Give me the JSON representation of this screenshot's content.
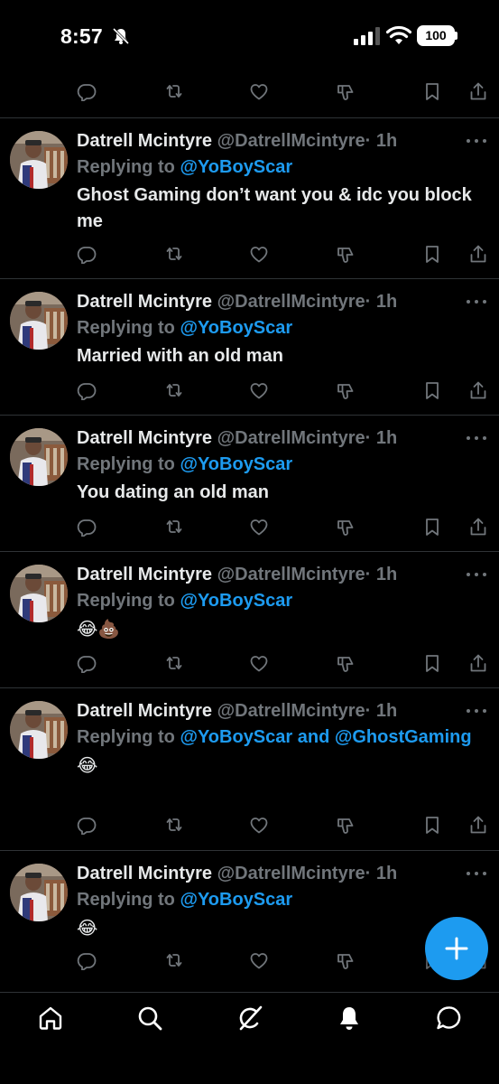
{
  "status_bar": {
    "time": "8:57",
    "battery": "100"
  },
  "icons": {
    "reply": "reply-icon",
    "retweet": "retweet-icon",
    "like": "like-icon",
    "downvote": "downvote-icon",
    "bookmark": "bookmark-icon",
    "share": "share-icon",
    "more": "more-icon",
    "compose": "plus-icon",
    "home": "home-icon",
    "search": "search-icon",
    "grok": "grok-icon",
    "notifications": "bell-icon",
    "messages": "messages-icon"
  },
  "colors": {
    "background": "#000000",
    "accent": "#1d9bf0",
    "muted": "#71767b",
    "text": "#e7e9ea"
  },
  "tweets": [
    {
      "name": "Datrell Mcintyre",
      "handle": "@DatrellMcintyre",
      "time": "· 1h",
      "replying_prefix": "Replying to ",
      "replying_to": "@YoBoyScar",
      "text": "Ghost Gaming don’t want you & idc you block me"
    },
    {
      "name": "Datrell Mcintyre",
      "handle": "@DatrellMcintyre",
      "time": "· 1h",
      "replying_prefix": "Replying to ",
      "replying_to": "@YoBoyScar",
      "text": "Married with an old man"
    },
    {
      "name": "Datrell Mcintyre",
      "handle": "@DatrellMcintyre",
      "time": "· 1h",
      "replying_prefix": "Replying to ",
      "replying_to": "@YoBoyScar",
      "text": "You dating an old man"
    },
    {
      "name": "Datrell Mcintyre",
      "handle": "@DatrellMcintyre",
      "time": "· 1h",
      "replying_prefix": "Replying to ",
      "replying_to": "@YoBoyScar",
      "text": "😂💩"
    },
    {
      "name": "Datrell Mcintyre",
      "handle": "@DatrellMcintyre",
      "time": "· 1h",
      "replying_prefix": "Replying to ",
      "replying_to": "@YoBoyScar and @GhostGaming",
      "text": "😂"
    },
    {
      "name": "Datrell Mcintyre",
      "handle": "@DatrellMcintyre",
      "time": "· 1h",
      "replying_prefix": "Replying to ",
      "replying_to": "@YoBoyScar",
      "text": "😂"
    }
  ]
}
